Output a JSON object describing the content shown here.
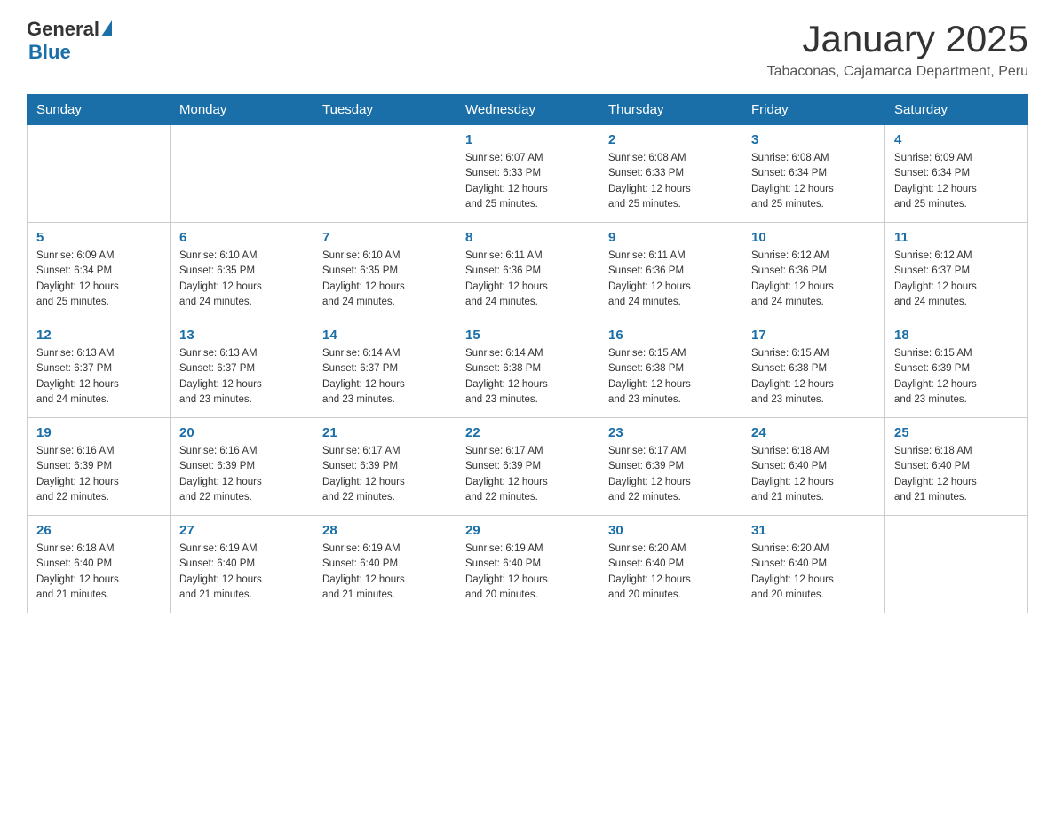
{
  "header": {
    "logo_general": "General",
    "logo_blue": "Blue",
    "title": "January 2025",
    "subtitle": "Tabaconas, Cajamarca Department, Peru"
  },
  "days_of_week": [
    "Sunday",
    "Monday",
    "Tuesday",
    "Wednesday",
    "Thursday",
    "Friday",
    "Saturday"
  ],
  "weeks": [
    [
      {
        "day": "",
        "info": ""
      },
      {
        "day": "",
        "info": ""
      },
      {
        "day": "",
        "info": ""
      },
      {
        "day": "1",
        "info": "Sunrise: 6:07 AM\nSunset: 6:33 PM\nDaylight: 12 hours\nand 25 minutes."
      },
      {
        "day": "2",
        "info": "Sunrise: 6:08 AM\nSunset: 6:33 PM\nDaylight: 12 hours\nand 25 minutes."
      },
      {
        "day": "3",
        "info": "Sunrise: 6:08 AM\nSunset: 6:34 PM\nDaylight: 12 hours\nand 25 minutes."
      },
      {
        "day": "4",
        "info": "Sunrise: 6:09 AM\nSunset: 6:34 PM\nDaylight: 12 hours\nand 25 minutes."
      }
    ],
    [
      {
        "day": "5",
        "info": "Sunrise: 6:09 AM\nSunset: 6:34 PM\nDaylight: 12 hours\nand 25 minutes."
      },
      {
        "day": "6",
        "info": "Sunrise: 6:10 AM\nSunset: 6:35 PM\nDaylight: 12 hours\nand 24 minutes."
      },
      {
        "day": "7",
        "info": "Sunrise: 6:10 AM\nSunset: 6:35 PM\nDaylight: 12 hours\nand 24 minutes."
      },
      {
        "day": "8",
        "info": "Sunrise: 6:11 AM\nSunset: 6:36 PM\nDaylight: 12 hours\nand 24 minutes."
      },
      {
        "day": "9",
        "info": "Sunrise: 6:11 AM\nSunset: 6:36 PM\nDaylight: 12 hours\nand 24 minutes."
      },
      {
        "day": "10",
        "info": "Sunrise: 6:12 AM\nSunset: 6:36 PM\nDaylight: 12 hours\nand 24 minutes."
      },
      {
        "day": "11",
        "info": "Sunrise: 6:12 AM\nSunset: 6:37 PM\nDaylight: 12 hours\nand 24 minutes."
      }
    ],
    [
      {
        "day": "12",
        "info": "Sunrise: 6:13 AM\nSunset: 6:37 PM\nDaylight: 12 hours\nand 24 minutes."
      },
      {
        "day": "13",
        "info": "Sunrise: 6:13 AM\nSunset: 6:37 PM\nDaylight: 12 hours\nand 23 minutes."
      },
      {
        "day": "14",
        "info": "Sunrise: 6:14 AM\nSunset: 6:37 PM\nDaylight: 12 hours\nand 23 minutes."
      },
      {
        "day": "15",
        "info": "Sunrise: 6:14 AM\nSunset: 6:38 PM\nDaylight: 12 hours\nand 23 minutes."
      },
      {
        "day": "16",
        "info": "Sunrise: 6:15 AM\nSunset: 6:38 PM\nDaylight: 12 hours\nand 23 minutes."
      },
      {
        "day": "17",
        "info": "Sunrise: 6:15 AM\nSunset: 6:38 PM\nDaylight: 12 hours\nand 23 minutes."
      },
      {
        "day": "18",
        "info": "Sunrise: 6:15 AM\nSunset: 6:39 PM\nDaylight: 12 hours\nand 23 minutes."
      }
    ],
    [
      {
        "day": "19",
        "info": "Sunrise: 6:16 AM\nSunset: 6:39 PM\nDaylight: 12 hours\nand 22 minutes."
      },
      {
        "day": "20",
        "info": "Sunrise: 6:16 AM\nSunset: 6:39 PM\nDaylight: 12 hours\nand 22 minutes."
      },
      {
        "day": "21",
        "info": "Sunrise: 6:17 AM\nSunset: 6:39 PM\nDaylight: 12 hours\nand 22 minutes."
      },
      {
        "day": "22",
        "info": "Sunrise: 6:17 AM\nSunset: 6:39 PM\nDaylight: 12 hours\nand 22 minutes."
      },
      {
        "day": "23",
        "info": "Sunrise: 6:17 AM\nSunset: 6:39 PM\nDaylight: 12 hours\nand 22 minutes."
      },
      {
        "day": "24",
        "info": "Sunrise: 6:18 AM\nSunset: 6:40 PM\nDaylight: 12 hours\nand 21 minutes."
      },
      {
        "day": "25",
        "info": "Sunrise: 6:18 AM\nSunset: 6:40 PM\nDaylight: 12 hours\nand 21 minutes."
      }
    ],
    [
      {
        "day": "26",
        "info": "Sunrise: 6:18 AM\nSunset: 6:40 PM\nDaylight: 12 hours\nand 21 minutes."
      },
      {
        "day": "27",
        "info": "Sunrise: 6:19 AM\nSunset: 6:40 PM\nDaylight: 12 hours\nand 21 minutes."
      },
      {
        "day": "28",
        "info": "Sunrise: 6:19 AM\nSunset: 6:40 PM\nDaylight: 12 hours\nand 21 minutes."
      },
      {
        "day": "29",
        "info": "Sunrise: 6:19 AM\nSunset: 6:40 PM\nDaylight: 12 hours\nand 20 minutes."
      },
      {
        "day": "30",
        "info": "Sunrise: 6:20 AM\nSunset: 6:40 PM\nDaylight: 12 hours\nand 20 minutes."
      },
      {
        "day": "31",
        "info": "Sunrise: 6:20 AM\nSunset: 6:40 PM\nDaylight: 12 hours\nand 20 minutes."
      },
      {
        "day": "",
        "info": ""
      }
    ]
  ]
}
